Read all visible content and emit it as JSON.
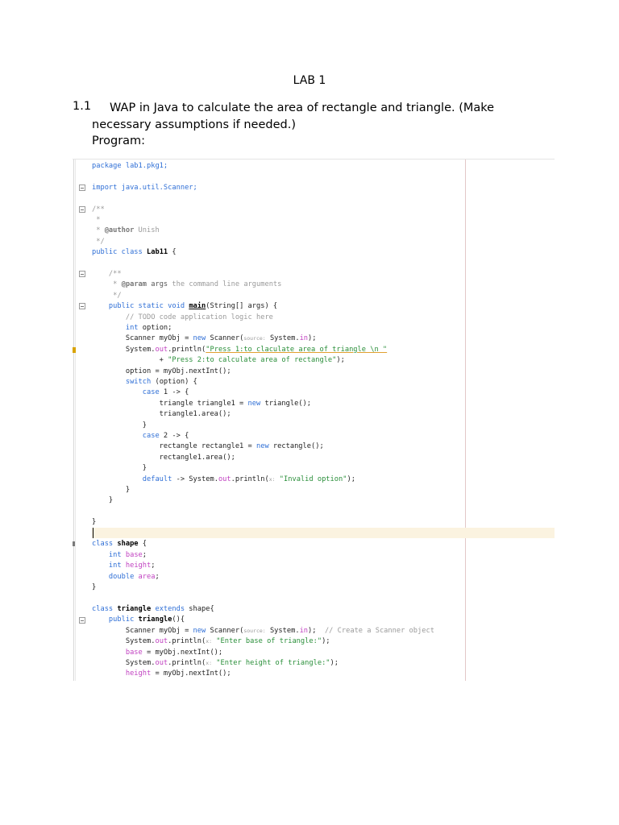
{
  "document": {
    "title": "LAB 1",
    "question_number": "1.1",
    "question_line1": "WAP in Java to calculate the area of rectangle and triangle. (Make",
    "question_line2": "necessary assumptions if needed.)",
    "question_line3": "Program:"
  },
  "code": {
    "l01": "package lab1.pkg1;",
    "l03": "import java.util.Scanner;",
    "l05": "/**",
    "l06": " *",
    "l07a": " * ",
    "l07b": "@author",
    "l07c": " Unish",
    "l08": " */",
    "l09a": "public class ",
    "l09b": "Lab11",
    "l09c": " {",
    "l11": "    /**",
    "l12a": "     * ",
    "l12b": "@param",
    "l12c": " args",
    "l12d": " the command line arguments",
    "l13": "     */",
    "l14a": "    public static void ",
    "l14b": "main",
    "l14c": "(String[] args) {",
    "l15": "        // TODO code application logic here",
    "l16a": "        int",
    "l16b": " option;",
    "l17a": "        Scanner myObj = ",
    "l17b": "new",
    "l17c": " Scanner(",
    "l17d": "source:",
    "l17e": " System.",
    "l17f": "in",
    "l17g": ");",
    "l18a": "        System.",
    "l18b": "out",
    "l18c": ".println(",
    "l18d": "\"Press 1:to claculate area of triangle \\n \"",
    "l19a": "                + ",
    "l19b": "\"Press 2:to calculate area of rectangle\"",
    "l19c": ");",
    "l20": "        option = myObj.nextInt();",
    "l21a": "        switch",
    "l21b": " (option) {",
    "l22a": "            case",
    "l22b": " 1 -> {",
    "l23a": "                triangle triangle1 = ",
    "l23b": "new",
    "l23c": " triangle();",
    "l24": "                triangle1.area();",
    "l25": "            }",
    "l26a": "            case",
    "l26b": " 2 -> {",
    "l27a": "                rectangle rectangle1 = ",
    "l27b": "new",
    "l27c": " rectangle();",
    "l28": "                rectangle1.area();",
    "l29": "            }",
    "l30a": "            default",
    "l30b": " -> System.",
    "l30c": "out",
    "l30d": ".println(",
    "l30e": "x:",
    "l30f": " \"Invalid option\"",
    "l30g": ");",
    "l31": "        }",
    "l32": "    }",
    "l34": "}",
    "l36a": "class ",
    "l36b": "shape",
    "l36c": " {",
    "l37a": "    int",
    "l37b": " base",
    "l37c": ";",
    "l38a": "    int",
    "l38b": " height",
    "l38c": ";",
    "l39a": "    double",
    "l39b": " area",
    "l39c": ";",
    "l40": "}",
    "l42a": "class ",
    "l42b": "triangle",
    "l42c": " extends",
    "l42d": " shape{",
    "l43a": "    public ",
    "l43b": "triangle",
    "l43c": "(){",
    "l44a": "        Scanner myObj = ",
    "l44b": "new",
    "l44c": " Scanner(",
    "l44d": "source:",
    "l44e": " System.",
    "l44f": "in",
    "l44g": ");  ",
    "l44h": "// Create a Scanner object",
    "l45a": "        System.",
    "l45b": "out",
    "l45c": ".println(",
    "l45d": "x:",
    "l45e": " \"Enter base of triangle:\"",
    "l45f": ");",
    "l46a": "        ",
    "l46b": "base",
    "l46c": " = myObj.nextInt();",
    "l47a": "        System.",
    "l47b": "out",
    "l47c": ".println(",
    "l47d": "x:",
    "l47e": " \"Enter height of triangle:\"",
    "l47f": ");",
    "l48a": "        ",
    "l48b": "height",
    "l48c": " = myObj.nextInt();"
  },
  "colors": {
    "keyword": "#2f6fd6",
    "comment": "#9a9a9a",
    "string": "#2a8f3a",
    "field": "#c142c1",
    "current_line": "#fbf3e0"
  }
}
